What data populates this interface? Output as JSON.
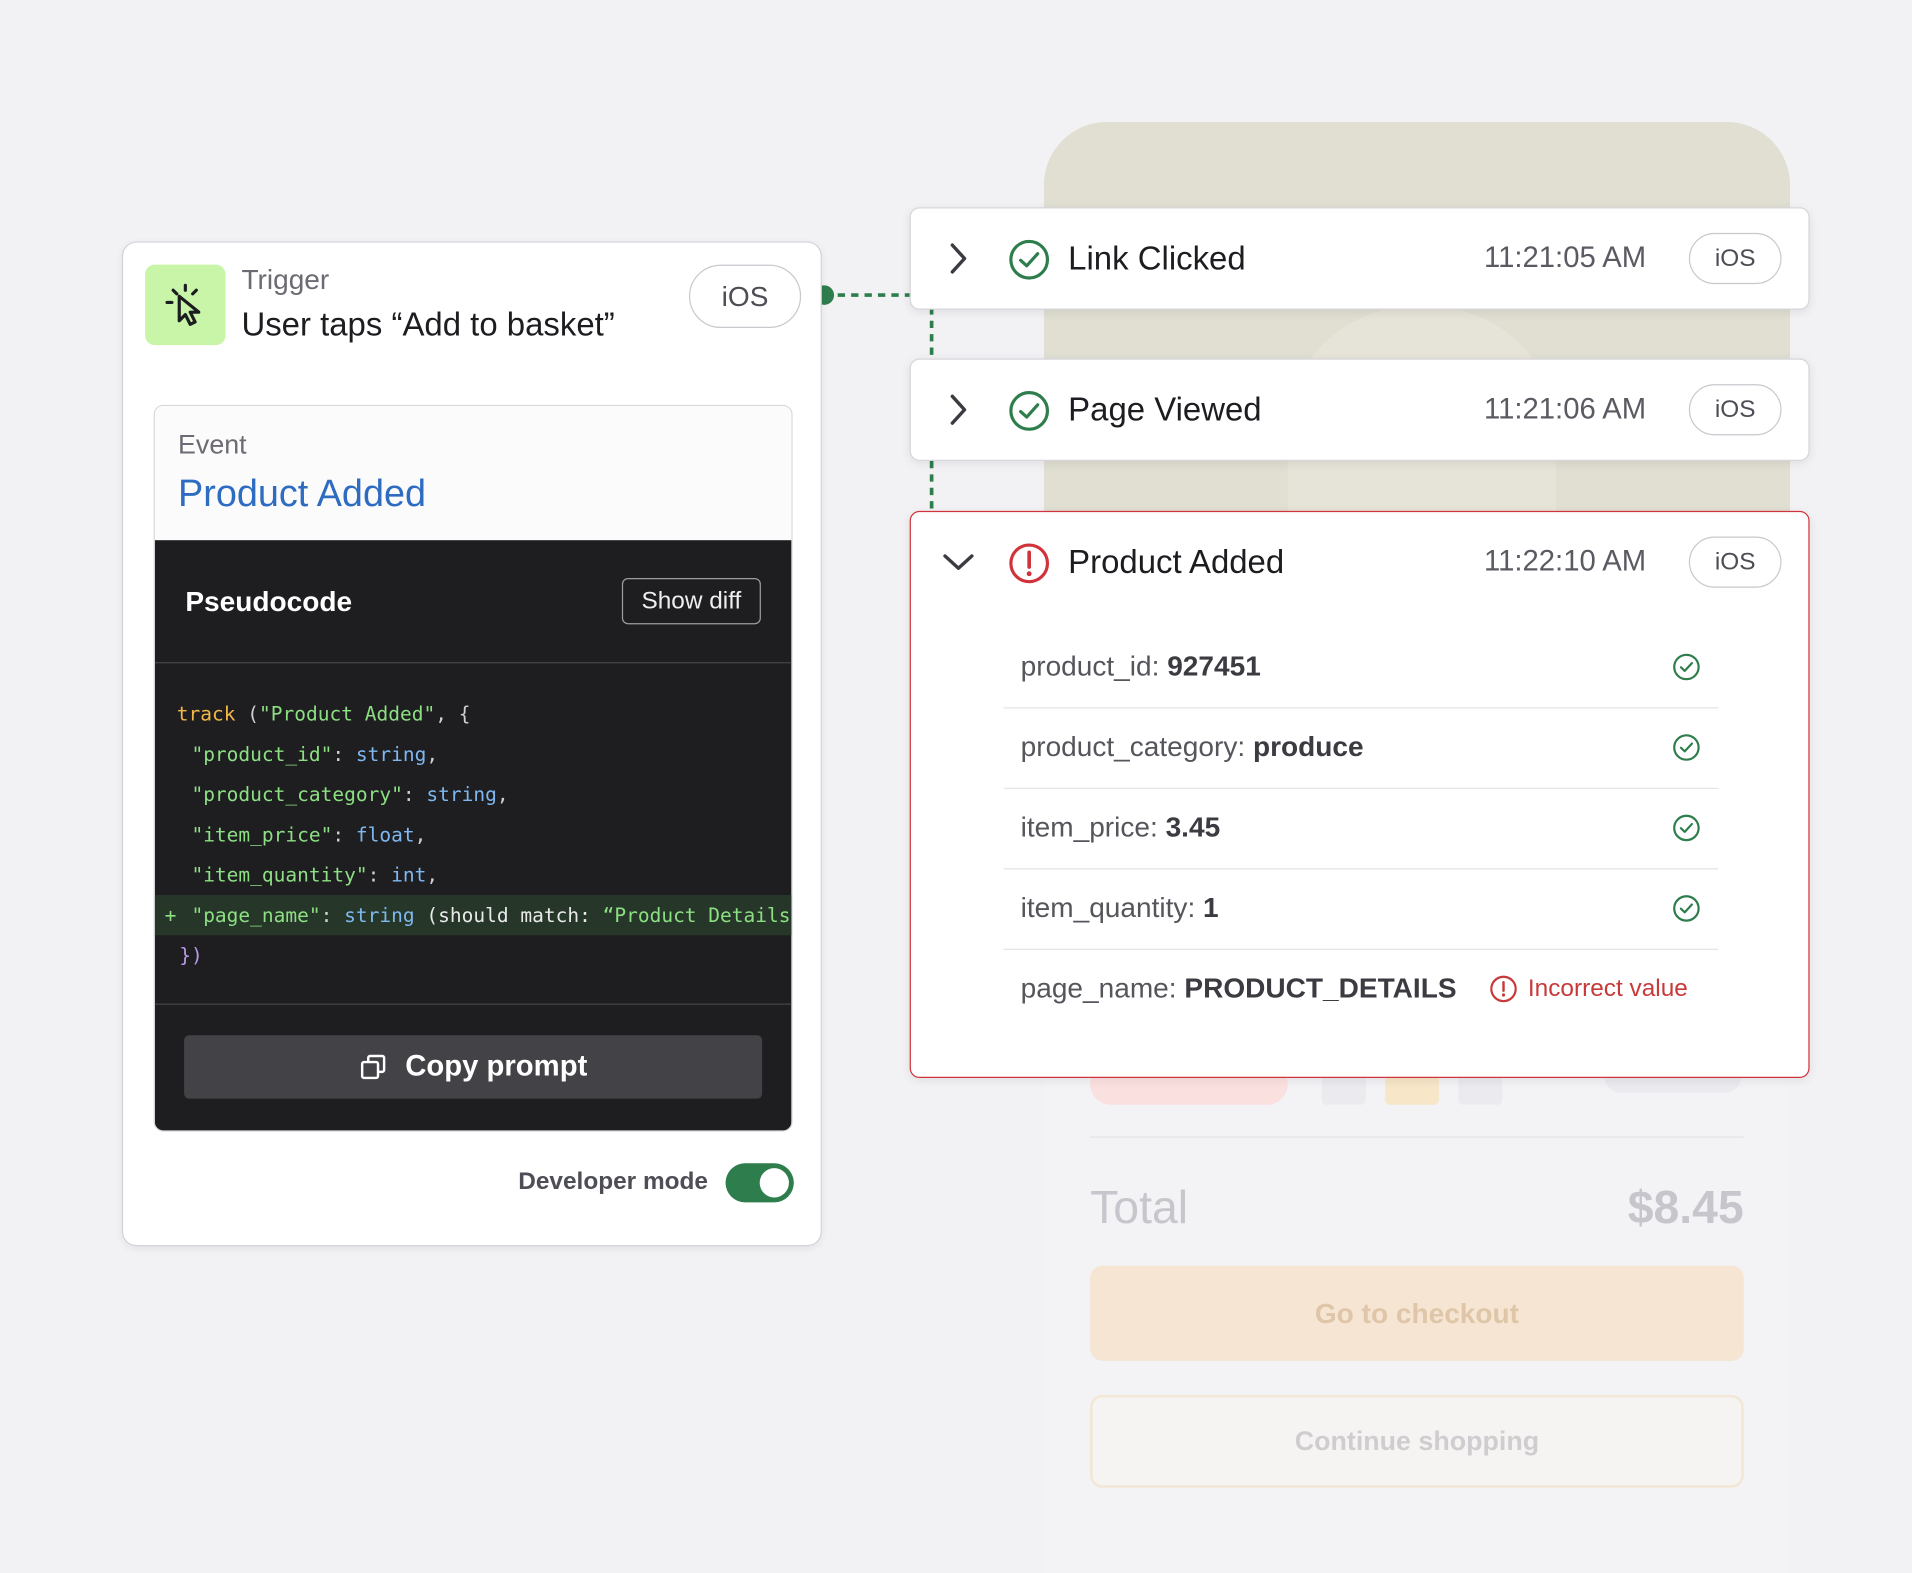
{
  "trigger": {
    "label": "Trigger",
    "title": "User taps “Add to basket”",
    "platform": "iOS"
  },
  "event": {
    "label": "Event",
    "name": "Product Added"
  },
  "pseudocode": {
    "title": "Pseudocode",
    "show_diff_label": "Show diff",
    "lines": [
      "track (\"Product Added\", {",
      "  \"product_id\": string,",
      "  \"product_category\": string,",
      "  \"item_price\": float,",
      "  \"item_quantity\": int,",
      "+ \"page_name\": string (should match: “Product Details”),",
      "})"
    ],
    "copy_label": "Copy prompt"
  },
  "developer_mode": {
    "label": "Developer mode",
    "enabled": true
  },
  "events_feed": [
    {
      "name": "Link Clicked",
      "time": "11:21:05 AM",
      "platform": "iOS",
      "status": "ok",
      "expanded": false
    },
    {
      "name": "Page Viewed",
      "time": "11:21:06 AM",
      "platform": "iOS",
      "status": "ok",
      "expanded": false
    },
    {
      "name": "Product Added",
      "time": "11:22:10 AM",
      "platform": "iOS",
      "status": "error",
      "expanded": true
    }
  ],
  "properties": [
    {
      "key": "product_id:",
      "value": "927451",
      "status": "ok"
    },
    {
      "key": "product_category:",
      "value": "produce",
      "status": "ok"
    },
    {
      "key": "item_price:",
      "value": "3.45",
      "status": "ok"
    },
    {
      "key": "item_quantity:",
      "value": "1",
      "status": "ok"
    },
    {
      "key": "page_name:",
      "value": "PRODUCT_DETAILS",
      "status": "error",
      "message": "Incorrect value"
    }
  ],
  "background_app": {
    "total_label": "Total",
    "total_value": "$8.45",
    "checkout_label": "Go to checkout",
    "continue_label": "Continue shopping"
  },
  "colors": {
    "accent_green": "#2e7d4c",
    "error_red": "#d0343a",
    "link_blue": "#2e6cc1",
    "trigger_icon_bg": "#c8f5a8"
  },
  "icons": {
    "trigger": "cursor-click-icon",
    "copy": "copy-icon",
    "ok": "check-circle-icon",
    "error": "alert-circle-icon",
    "collapsed": "chevron-right-icon",
    "expanded": "chevron-down-icon"
  }
}
